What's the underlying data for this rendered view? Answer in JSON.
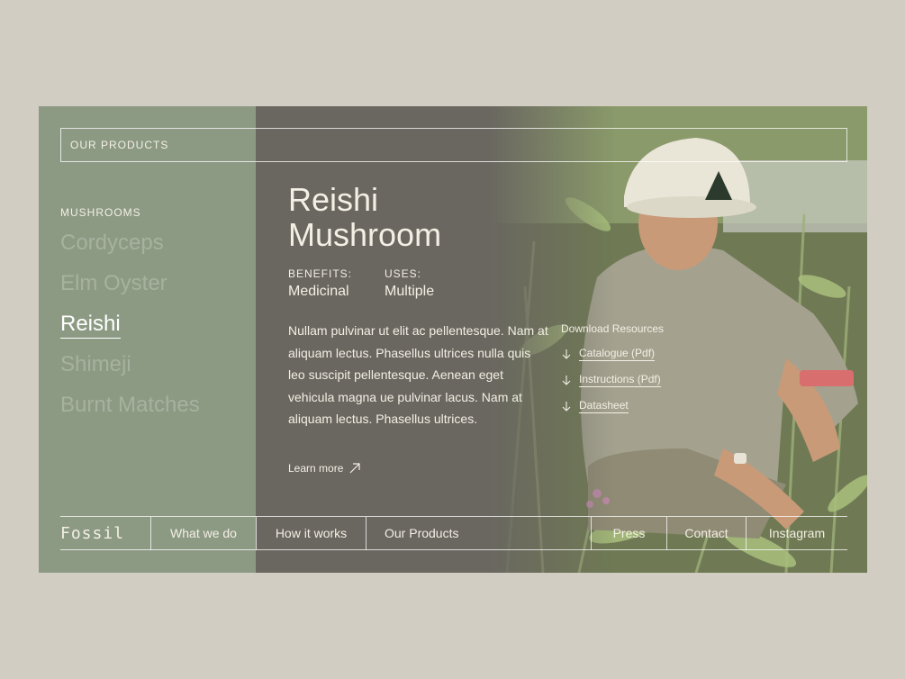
{
  "header": {
    "label": "OUR PRODUCTS"
  },
  "sidebar": {
    "category": "MUSHROOMS",
    "items": [
      {
        "label": "Cordyceps"
      },
      {
        "label": "Elm Oyster"
      },
      {
        "label": "Reishi"
      },
      {
        "label": "Shimeji"
      },
      {
        "label": "Burnt Matches"
      }
    ],
    "selected": "Reishi"
  },
  "product": {
    "title": "Reishi Mushroom",
    "benefits_label": "BENEFITS:",
    "benefits_value": "Medicinal",
    "uses_label": "USES:",
    "uses_value": "Multiple",
    "description": "Nullam pulvinar ut elit ac pellentesque. Nam at aliquam lectus. Phasellus ultrices nulla quis leo suscipit pellentesque. Aenean eget vehicula magna ue pulvinar lacus. Nam at aliquam lectus. Phasellus ultrices.",
    "learn_more": "Learn more"
  },
  "downloads": {
    "heading": "Download Resources",
    "items": [
      {
        "label": "Catalogue (Pdf)"
      },
      {
        "label": "Instructions (Pdf)"
      },
      {
        "label": "Datasheet"
      }
    ]
  },
  "footer": {
    "logo": "Fossil",
    "nav": [
      {
        "label": "What we do"
      },
      {
        "label": "How it works"
      },
      {
        "label": "Our Products"
      },
      {
        "label": "Press"
      },
      {
        "label": "Contact"
      },
      {
        "label": "Instagram"
      }
    ]
  },
  "colors": {
    "page_bg": "#d1cdc2",
    "sidebar_bg": "#8c9a84",
    "content_bg": "#6a6760",
    "text": "#f3efe4"
  },
  "icons": {
    "learn_more": "arrow-up-right-icon",
    "download": "arrow-down-icon"
  }
}
